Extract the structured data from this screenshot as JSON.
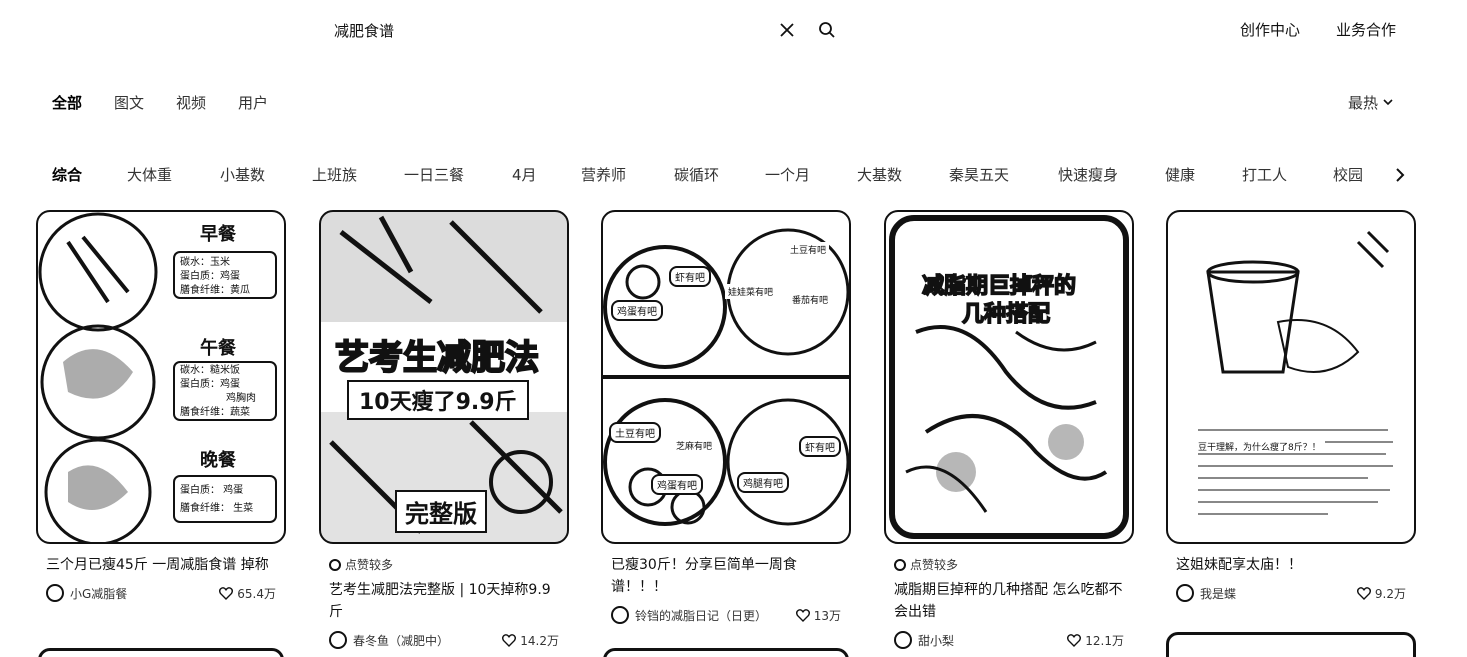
{
  "search": {
    "query": "减肥食谱"
  },
  "header": {
    "creator_center": "创作中心",
    "business": "业务合作"
  },
  "type_tabs": [
    "全部",
    "图文",
    "视频",
    "用户"
  ],
  "sort": {
    "label": "最热"
  },
  "tags": [
    "综合",
    "大体重",
    "小基数",
    "上班族",
    "一日三餐",
    "4月",
    "营养师",
    "碳循环",
    "一个月",
    "大基数",
    "秦昊五天",
    "快速瘦身",
    "健康",
    "打工人",
    "校园"
  ],
  "cards": [
    {
      "cover": {
        "meals": [
          "早餐",
          "午餐",
          "晚餐"
        ],
        "lines": [
          "碳水：玉米",
          "蛋白质：鸡蛋",
          "膳食纤维：黄瓜",
          "碳水：糙米饭",
          "蛋白质：鸡蛋",
          "鸡胸肉",
          "膳食纤维：蔬菜",
          "蛋白质： 鸡蛋",
          "膳食纤维： 生菜"
        ]
      },
      "title": "三个月已瘦45斤 一周减脂食谱 掉称",
      "author": "小G减脂餐",
      "likes": "65.4万"
    },
    {
      "cover": {
        "headline": "艺考生减肥法",
        "subline": "10天瘦了9.9斤",
        "footer": "完整版"
      },
      "badge": "点赞较多",
      "title": "艺考生减肥法完整版 | 10天掉称9.9斤",
      "author": "春冬鱼（减肥中）",
      "likes": "14.2万"
    },
    {
      "cover": {
        "labels": [
          "虾有吧",
          "鸡蛋有吧",
          "土豆有吧",
          "娃娃菜有吧",
          "番茄有吧",
          "土豆有吧",
          "芝麻有吧",
          "鸡蛋有吧",
          "鸡腿有吧",
          "虾有吧"
        ]
      },
      "title": "已瘦30斤！分享巨简单一周食谱！！！",
      "author": "铃铛的减脂日记（日更）",
      "likes": "13万"
    },
    {
      "cover": {
        "headline": "减脂期巨掉秤的",
        "subline": "几种搭配"
      },
      "badge": "点赞较多",
      "title": "减脂期巨掉秤的几种搭配 怎么吃都不会出错",
      "author": "甜小梨",
      "likes": "12.1万"
    },
    {
      "cover": {
        "text": "豆干理解，为什么瘦了8斤？！"
      },
      "title": "这姐妹配享太庙！！",
      "author": "我是蝶",
      "likes": "9.2万"
    }
  ]
}
